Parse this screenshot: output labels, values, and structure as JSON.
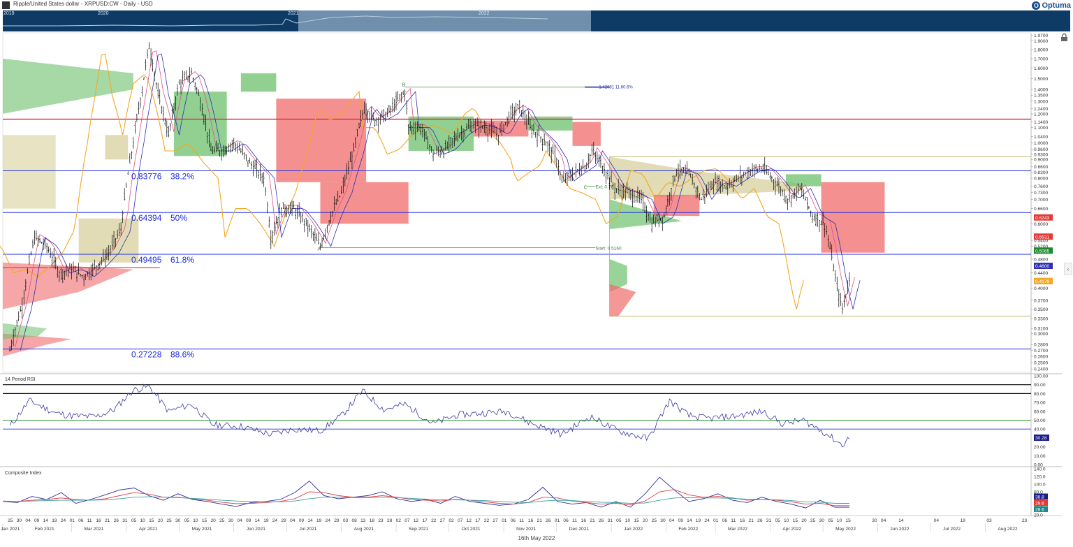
{
  "window": {
    "title": "Ripple/United States dollar - XRPUSD:CW - Daily - USD",
    "brand": "Optuma",
    "bottom_date": "16th May 2022"
  },
  "navigator": {
    "years": [
      "2019",
      "2020",
      "2021",
      "2022"
    ]
  },
  "colors": {
    "nav_bg": "#0d3b66",
    "nav_window": "#6f8fad",
    "candle": "#000000",
    "fib_line": "#1f2fdc",
    "resistance_line": "#e0304a",
    "cloud_bull": "#6cc06c",
    "cloud_bear": "#f06b6b",
    "chikou": "#f5a623",
    "kijun": "#2f2fb3",
    "tenkan": "#e05080",
    "vp_bull": "#c9c07a",
    "rsi_line": "#3a3aa0",
    "ci_line": "#2a2aa0",
    "ci_fast_ma": "#e04040",
    "ci_slow_ma": "#3aa0a0"
  },
  "chart_data": [
    {
      "type": "line",
      "title": "Ripple/United States dollar - XRPUSD:CW - Daily - USD",
      "scale": "log",
      "ylim": [
        0.235,
        2.0
      ],
      "y_ticks": [
        "1.9700",
        "1.9000",
        "1.8000",
        "1.7000",
        "1.6000",
        "1.5000",
        "1.4000",
        "1.3500",
        "1.3000",
        "1.2400",
        "1.2000",
        "1.1400",
        "1.1000",
        "1.0400",
        "1.0000",
        "0.9600",
        "0.9300",
        "0.9000",
        "0.8600",
        "0.8300",
        "0.8000",
        "0.7600",
        "0.7300",
        "0.7000",
        "0.6600",
        "0.6000",
        "0.5400",
        "0.5200",
        "0.4800",
        "0.4400",
        "0.4000",
        "0.3700",
        "0.3500",
        "0.3300",
        "0.3100",
        "0.3000",
        "0.2800",
        "0.2700",
        "0.2600",
        "0.2500",
        "0.2400"
      ],
      "x_ticks": [
        "25",
        "30",
        "04",
        "09",
        "14",
        "19",
        "24",
        "01",
        "06",
        "11",
        "16",
        "21",
        "26",
        "31",
        "05",
        "10",
        "15",
        "20",
        "25",
        "30",
        "05",
        "10",
        "15",
        "20",
        "25",
        "30",
        "04",
        "09",
        "14",
        "19",
        "24",
        "29",
        "04",
        "09",
        "14",
        "19",
        "24",
        "29",
        "03",
        "08",
        "13",
        "18",
        "23",
        "28",
        "02",
        "07",
        "12",
        "17",
        "22",
        "27",
        "02",
        "07",
        "12",
        "17",
        "22",
        "27",
        "01",
        "06",
        "11",
        "16",
        "21",
        "26",
        "01",
        "06",
        "11",
        "16",
        "21",
        "26",
        "31",
        "05",
        "10",
        "15",
        "20",
        "25",
        "30",
        "04",
        "09",
        "14",
        "19",
        "24",
        "01",
        "06",
        "11",
        "16",
        "21",
        "26",
        "31",
        "05",
        "10",
        "15",
        "20",
        "25",
        "30",
        "05",
        "10",
        "15",
        "30",
        "04",
        "14",
        "04",
        "19",
        "03",
        "23"
      ],
      "months": [
        "Jan 2021",
        "Feb 2021",
        "Mar 2021",
        "Apr 2021",
        "May 2021",
        "Jun 2021",
        "Jul 2021",
        "Aug 2021",
        "Sep 2021",
        "Oct 2021",
        "Nov 2021",
        "Dec 2021",
        "Jan 2022",
        "Feb 2022",
        "Mar 2022",
        "Apr 2022",
        "May 2022",
        "Jun 2022",
        "Jul 2022",
        "Aug 2022"
      ],
      "price_path": [
        [
          "2021-01-25",
          0.27
        ],
        [
          "2021-02-01",
          0.36
        ],
        [
          "2021-02-08",
          0.55
        ],
        [
          "2021-02-15",
          0.52
        ],
        [
          "2021-02-22",
          0.44
        ],
        [
          "2021-03-01",
          0.45
        ],
        [
          "2021-03-08",
          0.43
        ],
        [
          "2021-03-15",
          0.46
        ],
        [
          "2021-03-22",
          0.5
        ],
        [
          "2021-03-29",
          0.58
        ],
        [
          "2021-04-05",
          1.0
        ],
        [
          "2021-04-10",
          1.4
        ],
        [
          "2021-04-14",
          1.85
        ],
        [
          "2021-04-19",
          1.35
        ],
        [
          "2021-04-25",
          1.05
        ],
        [
          "2021-05-01",
          1.45
        ],
        [
          "2021-05-08",
          1.55
        ],
        [
          "2021-05-13",
          1.3
        ],
        [
          "2021-05-19",
          0.95
        ],
        [
          "2021-05-25",
          0.95
        ],
        [
          "2021-06-01",
          1.0
        ],
        [
          "2021-06-10",
          0.88
        ],
        [
          "2021-06-18",
          0.8
        ],
        [
          "2021-06-22",
          0.55
        ],
        [
          "2021-06-28",
          0.66
        ],
        [
          "2021-07-05",
          0.66
        ],
        [
          "2021-07-12",
          0.6
        ],
        [
          "2021-07-20",
          0.52
        ],
        [
          "2021-07-26",
          0.63
        ],
        [
          "2021-08-01",
          0.73
        ],
        [
          "2021-08-08",
          0.95
        ],
        [
          "2021-08-14",
          1.25
        ],
        [
          "2021-08-20",
          1.15
        ],
        [
          "2021-08-27",
          1.2
        ],
        [
          "2021-09-06",
          1.38
        ],
        [
          "2021-09-08",
          1.1
        ],
        [
          "2021-09-15",
          1.1
        ],
        [
          "2021-09-22",
          0.93
        ],
        [
          "2021-09-29",
          0.96
        ],
        [
          "2021-10-06",
          1.05
        ],
        [
          "2021-10-15",
          1.12
        ],
        [
          "2021-10-22",
          1.1
        ],
        [
          "2021-10-29",
          1.05
        ],
        [
          "2021-11-05",
          1.2
        ],
        [
          "2021-11-10",
          1.25
        ],
        [
          "2021-11-16",
          1.1
        ],
        [
          "2021-11-25",
          1.0
        ],
        [
          "2021-12-01",
          0.9
        ],
        [
          "2021-12-04",
          0.78
        ],
        [
          "2021-12-10",
          0.82
        ],
        [
          "2021-12-18",
          0.87
        ],
        [
          "2021-12-21",
          0.95
        ],
        [
          "2021-12-27",
          0.86
        ],
        [
          "2022-01-03",
          0.75
        ],
        [
          "2022-01-10",
          0.73
        ],
        [
          "2022-01-18",
          0.7
        ],
        [
          "2022-01-24",
          0.6
        ],
        [
          "2022-01-31",
          0.63
        ],
        [
          "2022-02-07",
          0.84
        ],
        [
          "2022-02-14",
          0.82
        ],
        [
          "2022-02-21",
          0.7
        ],
        [
          "2022-02-28",
          0.78
        ],
        [
          "2022-03-07",
          0.76
        ],
        [
          "2022-03-14",
          0.8
        ],
        [
          "2022-03-21",
          0.84
        ],
        [
          "2022-03-28",
          0.85
        ],
        [
          "2022-04-04",
          0.78
        ],
        [
          "2022-04-11",
          0.7
        ],
        [
          "2022-04-18",
          0.75
        ],
        [
          "2022-04-25",
          0.63
        ],
        [
          "2022-05-02",
          0.6
        ],
        [
          "2022-05-09",
          0.4
        ],
        [
          "2022-05-12",
          0.35
        ],
        [
          "2022-05-16",
          0.42
        ]
      ],
      "fibonacci_levels": [
        {
          "price": 0.83776,
          "label": "0.83776",
          "ratio": "38.2%"
        },
        {
          "price": 0.64394,
          "label": "0.64394",
          "ratio": "50%"
        },
        {
          "price": 0.49495,
          "label": "0.49495",
          "ratio": "61.8%"
        },
        {
          "price": 0.27228,
          "label": "0.27228",
          "ratio": "88.6%"
        }
      ],
      "resistance_level": 1.16,
      "abc_points": [
        {
          "label": "A",
          "date": "2021-07-20",
          "price": 0.516
        },
        {
          "label": "B",
          "date": "2021-09-06",
          "price": 1.42
        },
        {
          "label": "C",
          "date": "2021-12-18",
          "price": 0.76
        }
      ],
      "annotations": {
        "ab_top": "1.42081 11.60.6%",
        "ext": "Ext: 0.76",
        "start": "Start: 0.5160"
      },
      "price_badges": [
        {
          "value": "0.6243",
          "color": "#e53935"
        },
        {
          "value": "0.5531",
          "color": "#e53935"
        },
        {
          "value": "0.5065",
          "color": "#1b8a2b"
        },
        {
          "value": "0.4600",
          "color": "#2f2fb3"
        },
        {
          "value": "0.4179",
          "color": "#22b022"
        },
        {
          "value": "0.4179",
          "color": "#f5a623"
        }
      ],
      "box_levels": [
        0.915,
        0.335
      ]
    },
    {
      "type": "line",
      "title": "14 Period RSI",
      "ylim": [
        0,
        100
      ],
      "y_ticks": [
        "100.00",
        "90.00",
        "80.00",
        "70.00",
        "60.00",
        "50.00",
        "40.00",
        "30.00",
        "20.00",
        "10.00",
        "0.00"
      ],
      "levels": [
        90,
        80,
        50,
        40
      ],
      "rsi_path": [
        [
          "2021-01-25",
          43
        ],
        [
          "2021-02-05",
          72
        ],
        [
          "2021-02-20",
          58
        ],
        [
          "2021-03-01",
          55
        ],
        [
          "2021-03-15",
          54
        ],
        [
          "2021-03-25",
          62
        ],
        [
          "2021-04-05",
          84
        ],
        [
          "2021-04-14",
          88
        ],
        [
          "2021-04-25",
          60
        ],
        [
          "2021-05-08",
          68
        ],
        [
          "2021-05-20",
          45
        ],
        [
          "2021-06-05",
          43
        ],
        [
          "2021-06-22",
          34
        ],
        [
          "2021-07-05",
          40
        ],
        [
          "2021-07-20",
          38
        ],
        [
          "2021-08-01",
          55
        ],
        [
          "2021-08-13",
          83
        ],
        [
          "2021-08-25",
          62
        ],
        [
          "2021-09-06",
          68
        ],
        [
          "2021-09-22",
          46
        ],
        [
          "2021-10-06",
          56
        ],
        [
          "2021-10-20",
          58
        ],
        [
          "2021-11-03",
          60
        ],
        [
          "2021-11-15",
          48
        ],
        [
          "2021-12-04",
          34
        ],
        [
          "2021-12-20",
          54
        ],
        [
          "2022-01-05",
          38
        ],
        [
          "2022-01-22",
          29
        ],
        [
          "2022-02-03",
          72
        ],
        [
          "2022-02-14",
          55
        ],
        [
          "2022-02-25",
          52
        ],
        [
          "2022-03-10",
          54
        ],
        [
          "2022-03-28",
          60
        ],
        [
          "2022-04-08",
          46
        ],
        [
          "2022-04-20",
          50
        ],
        [
          "2022-05-02",
          36
        ],
        [
          "2022-05-12",
          22
        ],
        [
          "2022-05-16",
          30.28
        ]
      ],
      "badge": {
        "value": "30.28",
        "color": "#1d1d8a"
      }
    },
    {
      "type": "line",
      "title": "Composite Index",
      "ylim": [
        20,
        140
      ],
      "y_ticks": [
        "140.0",
        "120.0",
        "100.0",
        "80.0",
        "60.0",
        "40.0",
        "20.0"
      ],
      "series": [
        {
          "name": "",
          "values": [
            55,
            52,
            68,
            60,
            78,
            50,
            60,
            72,
            85,
            90,
            70,
            58,
            75,
            60,
            55,
            48,
            42,
            52,
            55,
            60,
            78,
            108,
            70,
            62,
            66,
            70,
            80,
            62,
            55,
            60,
            50,
            68,
            55,
            50,
            45,
            48,
            60,
            92,
            55,
            48,
            52,
            40,
            55,
            40,
            75,
            118,
            85,
            55,
            62,
            75,
            58,
            52,
            66,
            55,
            48,
            38,
            58,
            40,
            38.8
          ]
        },
        {
          "name": "",
          "values": [
            56,
            55,
            58,
            60,
            64,
            60,
            58,
            62,
            70,
            78,
            74,
            66,
            66,
            62,
            58,
            53,
            49,
            50,
            52,
            55,
            62,
            80,
            78,
            70,
            66,
            66,
            70,
            66,
            60,
            58,
            56,
            60,
            58,
            54,
            50,
            48,
            52,
            66,
            64,
            56,
            52,
            48,
            50,
            46,
            56,
            80,
            86,
            72,
            66,
            68,
            64,
            58,
            60,
            58,
            54,
            48,
            50,
            44,
            29.6
          ]
        },
        {
          "name": "",
          "values": [
            55,
            55,
            56,
            57,
            58,
            58,
            58,
            59,
            62,
            66,
            67,
            66,
            65,
            63,
            61,
            58,
            56,
            55,
            54,
            54,
            56,
            62,
            66,
            66,
            65,
            65,
            66,
            65,
            63,
            61,
            59,
            59,
            58,
            57,
            55,
            53,
            52,
            56,
            58,
            57,
            55,
            53,
            52,
            50,
            51,
            58,
            64,
            65,
            64,
            64,
            63,
            61,
            60,
            59,
            57,
            54,
            53,
            50,
            28.6
          ]
        }
      ],
      "badges": [
        {
          "value": "38.8",
          "color": "#1d1d8a"
        },
        {
          "value": "29.6",
          "color": "#e53935"
        },
        {
          "value": "28.6",
          "color": "#1a8a8a"
        }
      ]
    }
  ]
}
